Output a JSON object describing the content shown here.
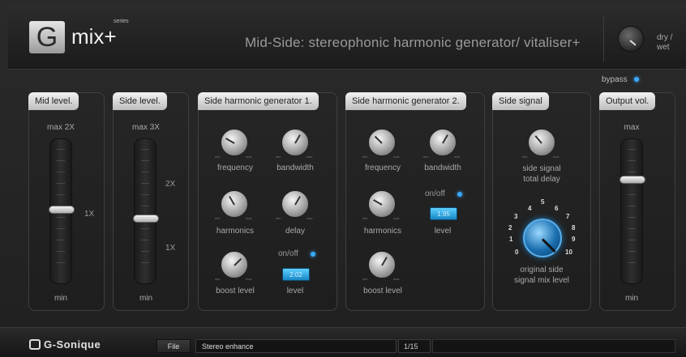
{
  "header": {
    "logo_letter": "G",
    "logo_name": "mix+",
    "logo_series": "series",
    "title": "Mid-Side: stereophonic harmonic generator/ vitaliser+",
    "dry_wet_label": "dry /\nwet"
  },
  "bypass": {
    "label": "bypass",
    "led_color": "#3aa9ff"
  },
  "knob_scale": {
    "min": "min",
    "max": "max"
  },
  "mid_level": {
    "title": "Mid level.",
    "top_label": "max 2X",
    "marker": "1X",
    "bottom_label": "min",
    "fader_position": 0.5
  },
  "side_level": {
    "title": "Side level.",
    "top_label": "max 3X",
    "marker_2x": "2X",
    "marker_1x": "1X",
    "bottom_label": "min",
    "fader_position": 0.45
  },
  "gen1": {
    "title": "Side harmonic generator 1.",
    "frequency": "frequency",
    "bandwidth": "bandwidth",
    "harmonics": "harmonics",
    "delay": "delay",
    "boost_level": "boost level",
    "onoff": "on/off",
    "level_value": "2.02",
    "level": "level"
  },
  "gen2": {
    "title": "Side harmonic generator 2.",
    "frequency": "frequency",
    "bandwidth": "bandwidth",
    "onoff": "on/off",
    "level_value": "1.95",
    "level": "level",
    "harmonics": "harmonics",
    "boost_level": "boost level"
  },
  "side_signal": {
    "title": "Side signal",
    "delay_label": "side signal\ntotal delay",
    "mix_label": "original side\nsignal mix level",
    "scale": [
      "0",
      "1",
      "2",
      "3",
      "4",
      "5",
      "6",
      "7",
      "8",
      "9",
      "10"
    ]
  },
  "output": {
    "title": "Output vol.",
    "top_label": "max",
    "bottom_label": "min",
    "fader_position": 0.75
  },
  "footer": {
    "brand": "G-Sonique",
    "file_button": "File",
    "preset_name": "Stereo enhance",
    "preset_counter": "1/15"
  },
  "colors": {
    "accent": "#3aa9ff",
    "panel_title_bg": "#d8d8d8",
    "background": "#242424"
  }
}
